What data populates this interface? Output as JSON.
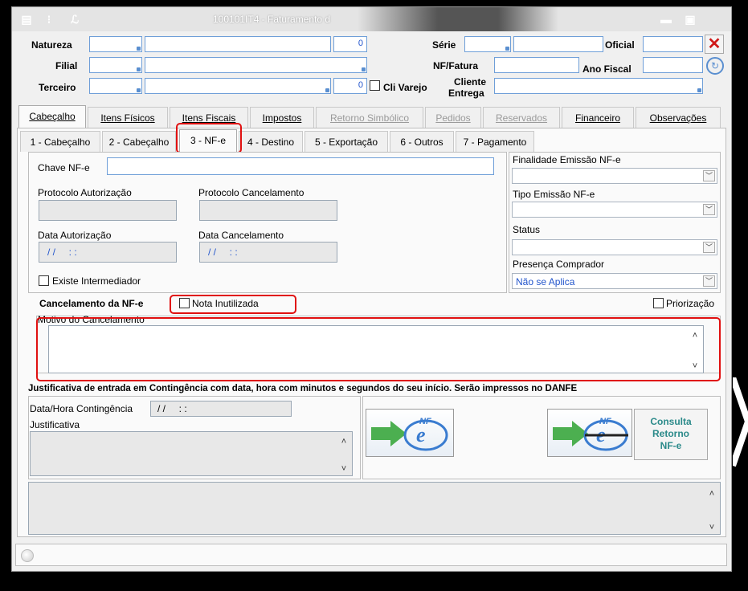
{
  "window": {
    "title": "100101IT4 - Faturamento d"
  },
  "titlebar_icons": [
    "menu-icon",
    "traffic-light-icon",
    "wrench-icon",
    "minimize-icon",
    "maximize-icon"
  ],
  "header": {
    "natureza": {
      "label": "Natureza",
      "value": "0"
    },
    "filial": {
      "label": "Filial"
    },
    "terceiro": {
      "label": "Terceiro",
      "value": "0"
    },
    "cli_varejo": {
      "label": "Cli Varejo"
    },
    "serie": {
      "label": "Série"
    },
    "oficial": {
      "label": "Oficial"
    },
    "nf_fatura": {
      "label": "NF/Fatura"
    },
    "ano_fiscal": {
      "label": "Ano Fiscal"
    },
    "cliente_entrega": {
      "label1": "Cliente",
      "label2": "Entrega"
    }
  },
  "tabs_main": [
    {
      "label": "Cabeçalho",
      "state": "active"
    },
    {
      "label": "Itens Físicos",
      "state": "normal"
    },
    {
      "label": "Itens Fiscais",
      "state": "normal"
    },
    {
      "label": "Impostos",
      "state": "normal"
    },
    {
      "label": "Retorno Simbólico",
      "state": "disabled"
    },
    {
      "label": "Pedidos",
      "state": "disabled"
    },
    {
      "label": "Reservados",
      "state": "disabled"
    },
    {
      "label": "Financeiro",
      "state": "normal"
    },
    {
      "label": "Observações",
      "state": "normal"
    }
  ],
  "tabs_sub": [
    {
      "label": "1 - Cabeçalho"
    },
    {
      "label": "2 - Cabeçalho"
    },
    {
      "label": "3 - NF-e"
    },
    {
      "label": "4 - Destino"
    },
    {
      "label": "5 - Exportação"
    },
    {
      "label": "6 - Outros"
    },
    {
      "label": "7 - Pagamento"
    }
  ],
  "nfe": {
    "chave_label": "Chave NF-e",
    "protocolo_aut_label": "Protocolo Autorização",
    "protocolo_canc_label": "Protocolo Cancelamento",
    "data_aut_label": "Data Autorização",
    "data_aut_value": "/ /     : :",
    "data_canc_label": "Data Cancelamento",
    "data_canc_value": "/ /     : :",
    "intermediador_label": "Existe Intermediador",
    "finalidade_label": "Finalidade Emissão NF-e",
    "tipo_emissao_label": "Tipo Emissão NF-e",
    "status_label": "Status",
    "presenca_label": "Presença Comprador",
    "presenca_value": "Não se Aplica",
    "cancelamento_label": "Cancelamento da NF-e",
    "nota_inutilizada_label": "Nota Inutilizada",
    "priorizacao_label": "Priorização",
    "motivo_label": "Motivo do Cancelamento"
  },
  "contingencia": {
    "heading": "Justificativa de entrada em Contingência com data, hora com minutos e segundos do seu início. Serão impressos no DANFE",
    "data_hora_label": "Data/Hora Contingência",
    "data_hora_value": "/ /     : :",
    "justificativa_label": "Justificativa",
    "consulta_button": "Consulta\nRetorno\nNF-e",
    "consulta_l1": "Consulta",
    "consulta_l2": "Retorno",
    "consulta_l3": "NF-e"
  },
  "colors": {
    "accent": "#3a7cd0",
    "highlight": "#e01010",
    "consulta_text": "#2b8a8a"
  }
}
